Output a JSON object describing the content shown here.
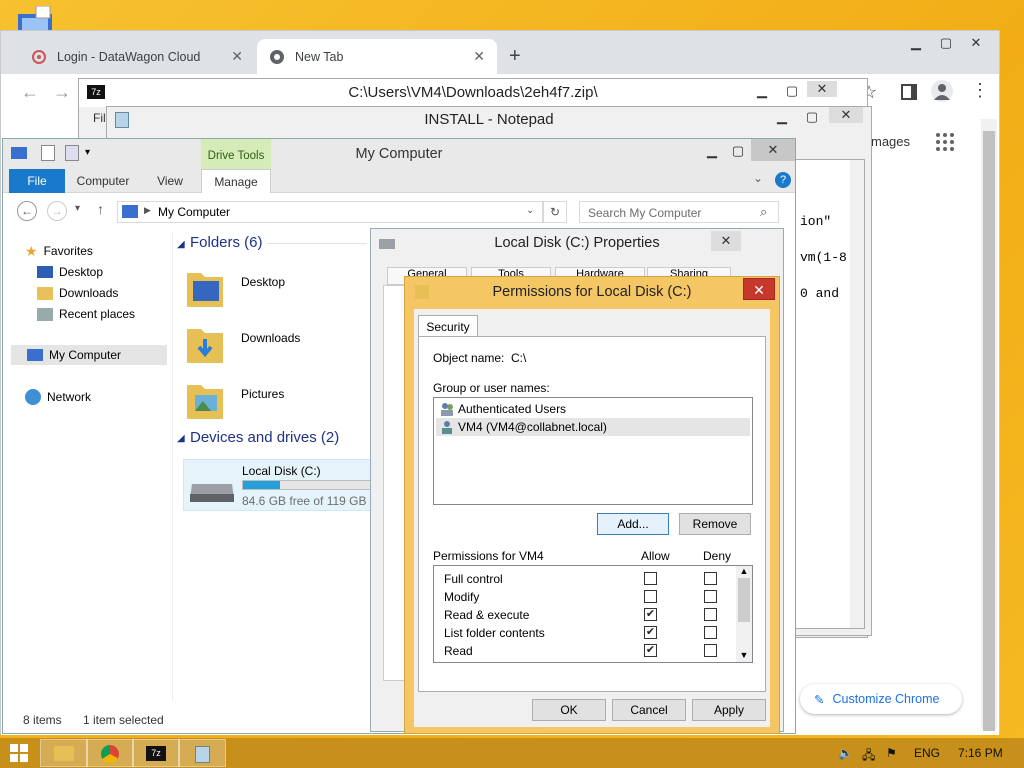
{
  "chrome": {
    "tabs": [
      {
        "title": "Login - DataWagon Cloud",
        "active": false
      },
      {
        "title": "New Tab",
        "active": true
      }
    ],
    "images_link": "mages",
    "customize_label": "Customize Chrome"
  },
  "sevenzip": {
    "title": "C:\\Users\\VM4\\Downloads\\2eh4f7.zip\\",
    "menu_partial": "Fil"
  },
  "notepad": {
    "title": "INSTALL - Notepad",
    "lines": [
      "ion\"",
      "vm(1-8",
      "0 and"
    ]
  },
  "explorer": {
    "title": "My Computer",
    "ribbon": {
      "context_group": "Drive Tools",
      "tabs": [
        "File",
        "Computer",
        "View",
        "Manage"
      ]
    },
    "address": "My Computer",
    "search_placeholder": "Search My Computer",
    "nav": {
      "favorites": "Favorites",
      "desktop": "Desktop",
      "downloads": "Downloads",
      "recent": "Recent places",
      "computer": "My Computer",
      "network": "Network"
    },
    "folders_header": "Folders (6)",
    "folders": [
      "Desktop",
      "Downloads",
      "Pictures"
    ],
    "drives_header": "Devices and drives (2)",
    "drive": {
      "name": "Local Disk (C:)",
      "free": "84.6 GB free of 119 GB",
      "used_fraction": 0.29
    },
    "status_items": "8 items",
    "status_selected": "1 item selected"
  },
  "properties": {
    "title": "Local Disk (C:) Properties",
    "tabs_partial": [
      "General",
      "Tools",
      "Hardware",
      "Sharing"
    ]
  },
  "permissions": {
    "title": "Permissions for Local Disk (C:)",
    "tab": "Security",
    "object_label": "Object name:",
    "object_value": "C:\\",
    "group_label": "Group or user names:",
    "users": [
      "Authenticated Users",
      "VM4 (VM4@collabnet.local)"
    ],
    "add_label": "Add...",
    "remove_label": "Remove",
    "perm_for": "Permissions for VM4",
    "allow_label": "Allow",
    "deny_label": "Deny",
    "perms": [
      {
        "name": "Full control",
        "allow": false,
        "deny": false
      },
      {
        "name": "Modify",
        "allow": false,
        "deny": false
      },
      {
        "name": "Read & execute",
        "allow": true,
        "deny": false
      },
      {
        "name": "List folder contents",
        "allow": true,
        "deny": false
      },
      {
        "name": "Read",
        "allow": true,
        "deny": false
      }
    ],
    "ok_label": "OK",
    "cancel_label": "Cancel",
    "apply_label": "Apply"
  },
  "taskbar": {
    "lang": "ENG",
    "time": "7:16 PM"
  }
}
